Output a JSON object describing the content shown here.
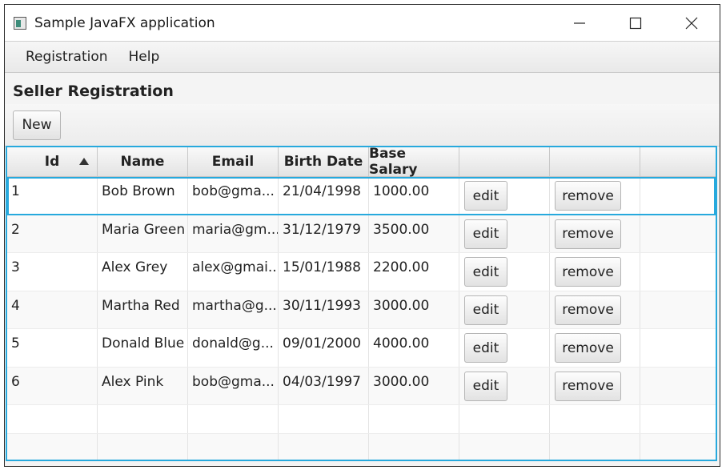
{
  "window": {
    "title": "Sample JavaFX application",
    "controls": [
      "minimize",
      "maximize",
      "close"
    ]
  },
  "menubar": {
    "items": [
      "Registration",
      "Help"
    ]
  },
  "heading": "Seller Registration",
  "toolbar": {
    "new_label": "New"
  },
  "table": {
    "columns": [
      "Id",
      "Name",
      "Email",
      "Birth Date",
      "Base Salary",
      "",
      "",
      ""
    ],
    "sort": {
      "column": "Id",
      "direction": "ascending"
    },
    "edit_label": "edit",
    "remove_label": "remove",
    "rows": [
      {
        "id": "1",
        "name": "Bob Brown",
        "email": "bob@gma...",
        "birth_date": "21/04/1998",
        "base_salary": "1000.00"
      },
      {
        "id": "2",
        "name": "Maria Green",
        "email": "maria@gm...",
        "birth_date": "31/12/1979",
        "base_salary": "3500.00"
      },
      {
        "id": "3",
        "name": "Alex Grey",
        "email": "alex@gmai...",
        "birth_date": "15/01/1988",
        "base_salary": "2200.00"
      },
      {
        "id": "4",
        "name": "Martha Red",
        "email": "martha@g...",
        "birth_date": "30/11/1993",
        "base_salary": "3000.00"
      },
      {
        "id": "5",
        "name": "Donald Blue",
        "email": "donald@g...",
        "birth_date": "09/01/2000",
        "base_salary": "4000.00"
      },
      {
        "id": "6",
        "name": "Alex Pink",
        "email": "bob@gma...",
        "birth_date": "04/03/1997",
        "base_salary": "3000.00"
      }
    ],
    "selected_row": 0
  },
  "colors": {
    "accent": "#27a9dd",
    "row_alt": "#f9f9f9"
  }
}
